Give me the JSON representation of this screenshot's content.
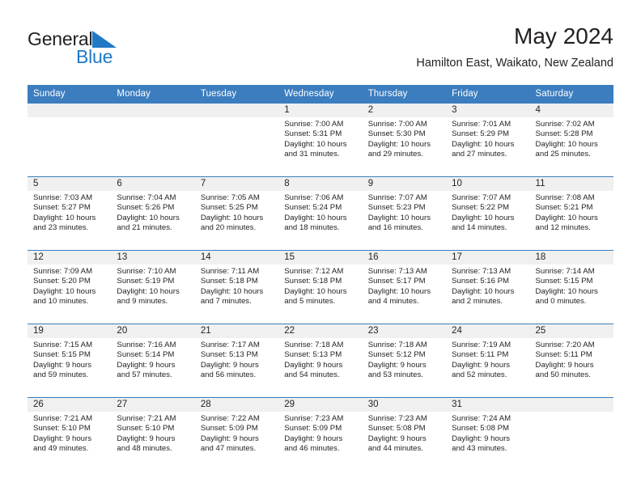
{
  "brand": {
    "line1": "General",
    "line2": "Blue",
    "triangle_icon": "brand-triangle-icon",
    "color_text": "#231f20",
    "color_blue": "#2079c7"
  },
  "header": {
    "title": "May 2024",
    "subtitle": "Hamilton East, Waikato, New Zealand"
  },
  "theme": {
    "header_bg": "#3b7dbf",
    "header_text": "#ffffff",
    "daynum_bg": "#f0f0f0",
    "row_border": "#3b7dbf",
    "body_text": "#231f20"
  },
  "weekdays": [
    "Sunday",
    "Monday",
    "Tuesday",
    "Wednesday",
    "Thursday",
    "Friday",
    "Saturday"
  ],
  "weeks": [
    [
      {
        "day": "",
        "empty": true
      },
      {
        "day": "",
        "empty": true
      },
      {
        "day": "",
        "empty": true
      },
      {
        "day": "1",
        "sunrise": "Sunrise: 7:00 AM",
        "sunset": "Sunset: 5:31 PM",
        "daylight": "Daylight: 10 hours and 31 minutes."
      },
      {
        "day": "2",
        "sunrise": "Sunrise: 7:00 AM",
        "sunset": "Sunset: 5:30 PM",
        "daylight": "Daylight: 10 hours and 29 minutes."
      },
      {
        "day": "3",
        "sunrise": "Sunrise: 7:01 AM",
        "sunset": "Sunset: 5:29 PM",
        "daylight": "Daylight: 10 hours and 27 minutes."
      },
      {
        "day": "4",
        "sunrise": "Sunrise: 7:02 AM",
        "sunset": "Sunset: 5:28 PM",
        "daylight": "Daylight: 10 hours and 25 minutes."
      }
    ],
    [
      {
        "day": "5",
        "sunrise": "Sunrise: 7:03 AM",
        "sunset": "Sunset: 5:27 PM",
        "daylight": "Daylight: 10 hours and 23 minutes."
      },
      {
        "day": "6",
        "sunrise": "Sunrise: 7:04 AM",
        "sunset": "Sunset: 5:26 PM",
        "daylight": "Daylight: 10 hours and 21 minutes."
      },
      {
        "day": "7",
        "sunrise": "Sunrise: 7:05 AM",
        "sunset": "Sunset: 5:25 PM",
        "daylight": "Daylight: 10 hours and 20 minutes."
      },
      {
        "day": "8",
        "sunrise": "Sunrise: 7:06 AM",
        "sunset": "Sunset: 5:24 PM",
        "daylight": "Daylight: 10 hours and 18 minutes."
      },
      {
        "day": "9",
        "sunrise": "Sunrise: 7:07 AM",
        "sunset": "Sunset: 5:23 PM",
        "daylight": "Daylight: 10 hours and 16 minutes."
      },
      {
        "day": "10",
        "sunrise": "Sunrise: 7:07 AM",
        "sunset": "Sunset: 5:22 PM",
        "daylight": "Daylight: 10 hours and 14 minutes."
      },
      {
        "day": "11",
        "sunrise": "Sunrise: 7:08 AM",
        "sunset": "Sunset: 5:21 PM",
        "daylight": "Daylight: 10 hours and 12 minutes."
      }
    ],
    [
      {
        "day": "12",
        "sunrise": "Sunrise: 7:09 AM",
        "sunset": "Sunset: 5:20 PM",
        "daylight": "Daylight: 10 hours and 10 minutes."
      },
      {
        "day": "13",
        "sunrise": "Sunrise: 7:10 AM",
        "sunset": "Sunset: 5:19 PM",
        "daylight": "Daylight: 10 hours and 9 minutes."
      },
      {
        "day": "14",
        "sunrise": "Sunrise: 7:11 AM",
        "sunset": "Sunset: 5:18 PM",
        "daylight": "Daylight: 10 hours and 7 minutes."
      },
      {
        "day": "15",
        "sunrise": "Sunrise: 7:12 AM",
        "sunset": "Sunset: 5:18 PM",
        "daylight": "Daylight: 10 hours and 5 minutes."
      },
      {
        "day": "16",
        "sunrise": "Sunrise: 7:13 AM",
        "sunset": "Sunset: 5:17 PM",
        "daylight": "Daylight: 10 hours and 4 minutes."
      },
      {
        "day": "17",
        "sunrise": "Sunrise: 7:13 AM",
        "sunset": "Sunset: 5:16 PM",
        "daylight": "Daylight: 10 hours and 2 minutes."
      },
      {
        "day": "18",
        "sunrise": "Sunrise: 7:14 AM",
        "sunset": "Sunset: 5:15 PM",
        "daylight": "Daylight: 10 hours and 0 minutes."
      }
    ],
    [
      {
        "day": "19",
        "sunrise": "Sunrise: 7:15 AM",
        "sunset": "Sunset: 5:15 PM",
        "daylight": "Daylight: 9 hours and 59 minutes."
      },
      {
        "day": "20",
        "sunrise": "Sunrise: 7:16 AM",
        "sunset": "Sunset: 5:14 PM",
        "daylight": "Daylight: 9 hours and 57 minutes."
      },
      {
        "day": "21",
        "sunrise": "Sunrise: 7:17 AM",
        "sunset": "Sunset: 5:13 PM",
        "daylight": "Daylight: 9 hours and 56 minutes."
      },
      {
        "day": "22",
        "sunrise": "Sunrise: 7:18 AM",
        "sunset": "Sunset: 5:13 PM",
        "daylight": "Daylight: 9 hours and 54 minutes."
      },
      {
        "day": "23",
        "sunrise": "Sunrise: 7:18 AM",
        "sunset": "Sunset: 5:12 PM",
        "daylight": "Daylight: 9 hours and 53 minutes."
      },
      {
        "day": "24",
        "sunrise": "Sunrise: 7:19 AM",
        "sunset": "Sunset: 5:11 PM",
        "daylight": "Daylight: 9 hours and 52 minutes."
      },
      {
        "day": "25",
        "sunrise": "Sunrise: 7:20 AM",
        "sunset": "Sunset: 5:11 PM",
        "daylight": "Daylight: 9 hours and 50 minutes."
      }
    ],
    [
      {
        "day": "26",
        "sunrise": "Sunrise: 7:21 AM",
        "sunset": "Sunset: 5:10 PM",
        "daylight": "Daylight: 9 hours and 49 minutes."
      },
      {
        "day": "27",
        "sunrise": "Sunrise: 7:21 AM",
        "sunset": "Sunset: 5:10 PM",
        "daylight": "Daylight: 9 hours and 48 minutes."
      },
      {
        "day": "28",
        "sunrise": "Sunrise: 7:22 AM",
        "sunset": "Sunset: 5:09 PM",
        "daylight": "Daylight: 9 hours and 47 minutes."
      },
      {
        "day": "29",
        "sunrise": "Sunrise: 7:23 AM",
        "sunset": "Sunset: 5:09 PM",
        "daylight": "Daylight: 9 hours and 46 minutes."
      },
      {
        "day": "30",
        "sunrise": "Sunrise: 7:23 AM",
        "sunset": "Sunset: 5:08 PM",
        "daylight": "Daylight: 9 hours and 44 minutes."
      },
      {
        "day": "31",
        "sunrise": "Sunrise: 7:24 AM",
        "sunset": "Sunset: 5:08 PM",
        "daylight": "Daylight: 9 hours and 43 minutes."
      },
      {
        "day": "",
        "empty": true
      }
    ]
  ]
}
